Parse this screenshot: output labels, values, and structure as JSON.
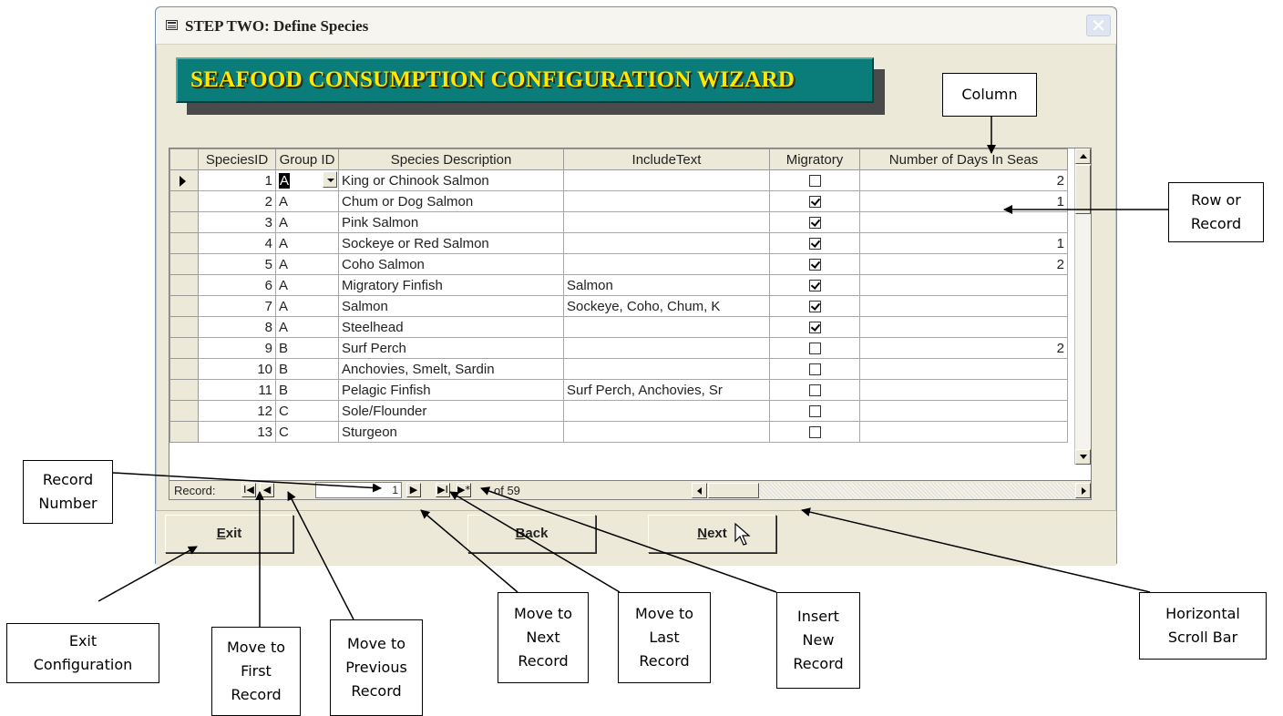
{
  "window": {
    "title": "STEP TWO:  Define Species",
    "close_glyph": "✕",
    "banner": "SEAFOOD CONSUMPTION CONFIGURATION WIZARD"
  },
  "grid": {
    "columns": [
      "SpeciesID",
      "Group ID",
      "Species Description",
      "IncludeText",
      "Migratory",
      "Number of Days In Seas"
    ],
    "rows": [
      {
        "id": "1",
        "group": "A",
        "desc": "King or Chinook Salmon",
        "include": "",
        "migratory": false,
        "days": "2"
      },
      {
        "id": "2",
        "group": "A",
        "desc": "Chum or Dog Salmon",
        "include": "",
        "migratory": true,
        "days": "1"
      },
      {
        "id": "3",
        "group": "A",
        "desc": "Pink Salmon",
        "include": "",
        "migratory": true,
        "days": ""
      },
      {
        "id": "4",
        "group": "A",
        "desc": "Sockeye or Red Salmon",
        "include": "",
        "migratory": true,
        "days": "1"
      },
      {
        "id": "5",
        "group": "A",
        "desc": "Coho Salmon",
        "include": "",
        "migratory": true,
        "days": "2"
      },
      {
        "id": "6",
        "group": "A",
        "desc": "Migratory Finfish",
        "include": "Salmon",
        "migratory": true,
        "days": ""
      },
      {
        "id": "7",
        "group": "A",
        "desc": "Salmon",
        "include": "Sockeye, Coho, Chum, K",
        "migratory": true,
        "days": ""
      },
      {
        "id": "8",
        "group": "A",
        "desc": "Steelhead",
        "include": "",
        "migratory": true,
        "days": ""
      },
      {
        "id": "9",
        "group": "B",
        "desc": "Surf Perch",
        "include": "",
        "migratory": false,
        "days": "2"
      },
      {
        "id": "10",
        "group": "B",
        "desc": "Anchovies, Smelt, Sardin",
        "include": "",
        "migratory": false,
        "days": ""
      },
      {
        "id": "11",
        "group": "B",
        "desc": "Pelagic Finfish",
        "include": "Surf Perch, Anchovies, Sr",
        "migratory": false,
        "days": ""
      },
      {
        "id": "12",
        "group": "C",
        "desc": "Sole/Flounder",
        "include": "",
        "migratory": false,
        "days": ""
      },
      {
        "id": "13",
        "group": "C",
        "desc": "Sturgeon",
        "include": "",
        "migratory": false,
        "days": ""
      }
    ]
  },
  "navigator": {
    "label": "Record:",
    "current": "1",
    "of_text": "of  59",
    "first_glyph": "I◀",
    "prev_glyph": "◀",
    "next_glyph": "▶",
    "last_glyph": "▶I",
    "new_glyph": "▶*"
  },
  "buttons": {
    "exit": {
      "mnemonic": "E",
      "rest": "xit"
    },
    "back": {
      "mnemonic": "B",
      "rest": "ack"
    },
    "next": {
      "mnemonic": "N",
      "rest": "ext"
    }
  },
  "callouts": {
    "column": "Column",
    "row_record": [
      "Row or",
      "Record"
    ],
    "record_number": [
      "Record",
      "Number"
    ],
    "exit_configuration": [
      "Exit",
      "Configuration"
    ],
    "move_first": [
      "Move to",
      "First",
      "Record"
    ],
    "move_previous": [
      "Move to",
      "Previous",
      "Record"
    ],
    "move_next": [
      "Move to",
      "Next",
      "Record"
    ],
    "move_last": [
      "Move to",
      "Last",
      "Record"
    ],
    "insert_new": [
      "Insert",
      "New",
      "Record"
    ],
    "horizontal_scroll": [
      "Horizontal",
      "Scroll Bar"
    ]
  }
}
